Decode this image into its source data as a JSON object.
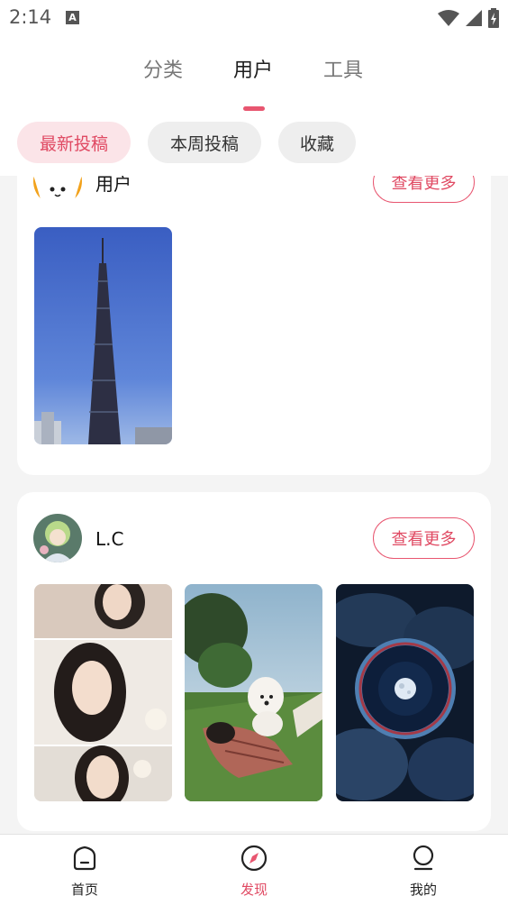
{
  "status_bar": {
    "time": "2:14",
    "notification_icon": "A"
  },
  "header": {
    "tabs": [
      {
        "label": "分类",
        "active": false
      },
      {
        "label": "用户",
        "active": true
      },
      {
        "label": "工具",
        "active": false
      }
    ],
    "chips": [
      {
        "label": "最新投稿",
        "active": true
      },
      {
        "label": "本周投稿",
        "active": false
      },
      {
        "label": "收藏",
        "active": false
      }
    ]
  },
  "feed": {
    "cards": [
      {
        "user": "用户",
        "more_label": "查看更多",
        "images": [
          "tv-tower-photo"
        ]
      },
      {
        "user": "L.C",
        "more_label": "查看更多",
        "images": [
          "portrait-collage-photo",
          "dog-on-lawn-photo",
          "moon-in-clouds-photo"
        ]
      }
    ]
  },
  "bottom_nav": {
    "items": [
      {
        "label": "首页",
        "icon": "home-icon",
        "active": false
      },
      {
        "label": "发现",
        "icon": "compass-icon",
        "active": true
      },
      {
        "label": "我的",
        "icon": "profile-icon",
        "active": false
      }
    ]
  },
  "colors": {
    "accent": "#e85670",
    "chip_active_bg": "#fbe4e8",
    "background": "#f4f4f4"
  }
}
